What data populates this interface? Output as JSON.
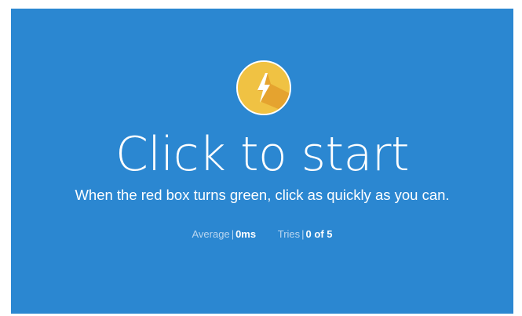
{
  "test": {
    "headline": "Click to start",
    "instruction": "When the red box turns green, click as quickly as you can.",
    "icon": "lightning-bolt-icon",
    "colors": {
      "panel_background": "#2b87d1",
      "icon_circle": "#f0c243",
      "icon_shadow": "#e39e2c",
      "text": "#ffffff",
      "muted_text": "#b9d6f0"
    }
  },
  "stats": {
    "separator": "|",
    "average": {
      "label": "Average",
      "value": "0ms"
    },
    "tries": {
      "label": "Tries",
      "value": "0 of 5"
    }
  }
}
